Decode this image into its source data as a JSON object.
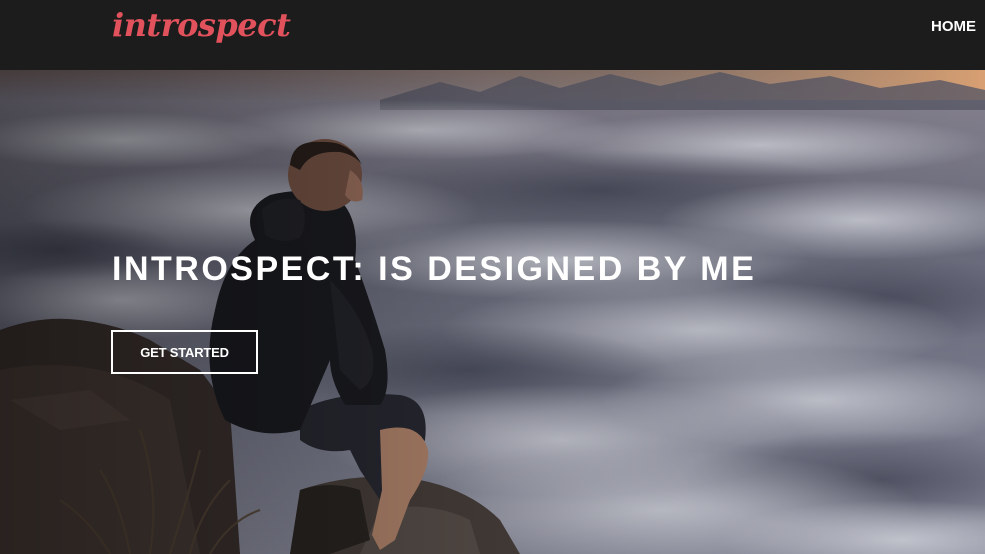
{
  "header": {
    "logo_text": "introspect",
    "nav": [
      {
        "label": "HOME"
      }
    ]
  },
  "hero": {
    "title": "INTROSPECT: IS DESIGNED BY ME",
    "cta_label": "GET STARTED",
    "background_image": "man-sitting-on-rock-above-clouds"
  },
  "colors": {
    "header_bg": "#1c1c1c",
    "logo": "#e2525c",
    "text": "#ffffff"
  }
}
